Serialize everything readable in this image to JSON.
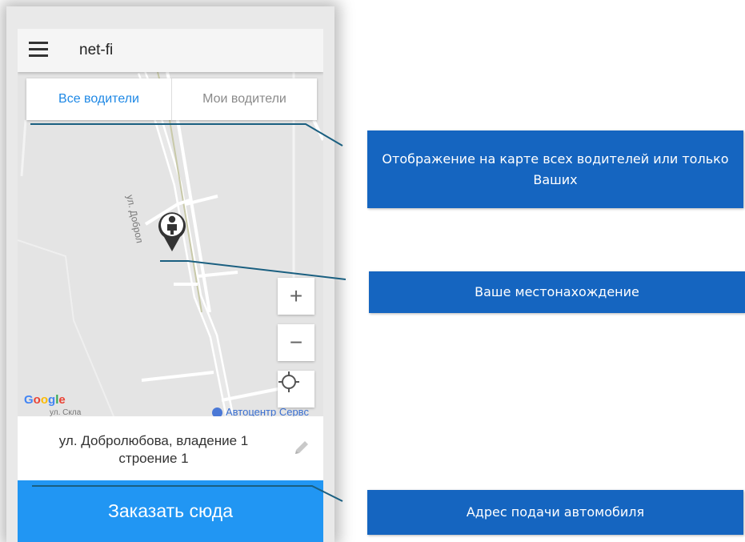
{
  "app": {
    "title": "net-fi",
    "menu_icon": "hamburger-menu-icon"
  },
  "tabs": {
    "all_drivers": "Все водители",
    "my_drivers": "Мои водители"
  },
  "map": {
    "street_vertical": "ул. Доброл",
    "street_bottom": "ул. Скла",
    "poi_label": "Автоцентр Сервс",
    "google_logo": "Google",
    "zoom_in": "+",
    "zoom_out": "−",
    "marker_icon": "person-location-pin-icon",
    "locate_icon": "my-location-crosshair-icon"
  },
  "address": {
    "line1": "ул. Добролюбова,  владение 1",
    "line2": "строение 1",
    "edit_icon": "pencil-icon"
  },
  "order_button": "Заказать сюда",
  "callouts": {
    "drivers_toggle": "Отображение на карте всех водителей или только Ваших",
    "your_location": "Ваше местонахождение",
    "pickup_address": "Адрес подачи автомобиля"
  },
  "colors": {
    "accent": "#2196f3",
    "callout": "#1565c0",
    "connector": "#1a5f80"
  }
}
